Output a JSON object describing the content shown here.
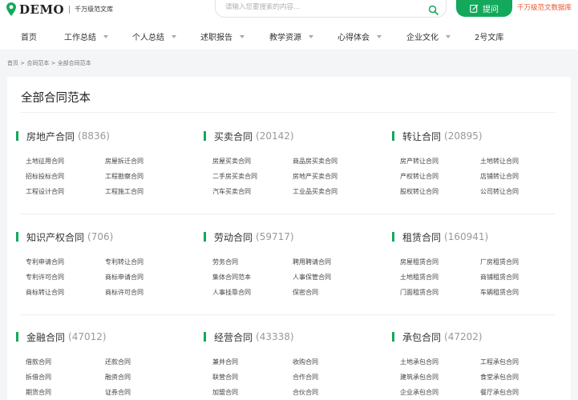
{
  "header": {
    "logo_text": "DEMO",
    "logo_sub": "千万级范文库",
    "search_placeholder": "请输入您要搜索的内容...",
    "ask_label": "提问",
    "db_link": "千万级范文数据库"
  },
  "nav": [
    {
      "label": "首页",
      "dropdown": false
    },
    {
      "label": "工作总结",
      "dropdown": true
    },
    {
      "label": "个人总结",
      "dropdown": true
    },
    {
      "label": "述职报告",
      "dropdown": true
    },
    {
      "label": "教学资源",
      "dropdown": true
    },
    {
      "label": "心得体会",
      "dropdown": true
    },
    {
      "label": "企业文化",
      "dropdown": true
    },
    {
      "label": "2号文库",
      "dropdown": false
    }
  ],
  "breadcrumb": {
    "home": "首页",
    "sep": ">",
    "parent": "合同范本",
    "current": "全部合同范本"
  },
  "page_title": "全部合同范本",
  "sections": [
    {
      "title": "房地产合同",
      "count": "(8836)",
      "items": [
        "土地征用合同",
        "房屋拆迁合同",
        "招标投标合同",
        "工程勘察合同",
        "工程设计合同",
        "工程施工合同"
      ]
    },
    {
      "title": "买卖合同",
      "count": "(20142)",
      "items": [
        "房屋买卖合同",
        "商品房买卖合同",
        "二手房买卖合同",
        "房地产买卖合同",
        "汽车买卖合同",
        "工业品买卖合同"
      ]
    },
    {
      "title": "转让合同",
      "count": "(20895)",
      "items": [
        "房产转让合同",
        "土地转让合同",
        "产权转让合同",
        "店铺转让合同",
        "股权转让合同",
        "公司转让合同"
      ]
    },
    {
      "title": "知识产权合同",
      "count": "(706)",
      "items": [
        "专利申请合同",
        "专利转让合同",
        "专利许可合同",
        "商标申请合同",
        "商标转让合同",
        "商标许可合同"
      ]
    },
    {
      "title": "劳动合同",
      "count": "(59717)",
      "items": [
        "劳务合同",
        "聘用聘请合同",
        "集体合同范本",
        "人事保管合同",
        "人事挂靠合同",
        "保密合同"
      ]
    },
    {
      "title": "租赁合同",
      "count": "(160941)",
      "items": [
        "房屋租赁合同",
        "厂房租赁合同",
        "土地租赁合同",
        "商铺租赁合同",
        "门面租赁合同",
        "车辆租赁合同"
      ]
    },
    {
      "title": "金融合同",
      "count": "(47012)",
      "items": [
        "借款合同",
        "还款合同",
        "拆借合同",
        "融资合同",
        "期货合同",
        "证券合同"
      ]
    },
    {
      "title": "经营合同",
      "count": "(43338)",
      "items": [
        "兼并合同",
        "收购合同",
        "联营合同",
        "合作合同",
        "加盟合同",
        "合伙合同"
      ]
    },
    {
      "title": "承包合同",
      "count": "(47202)",
      "items": [
        "土地承包合同",
        "工程承包合同",
        "建筑承包合同",
        "食堂承包合同",
        "企业承包合同",
        "餐厅承包合同"
      ]
    }
  ],
  "colors": {
    "accent": "#13a95b",
    "link_orange": "#e5572b"
  }
}
